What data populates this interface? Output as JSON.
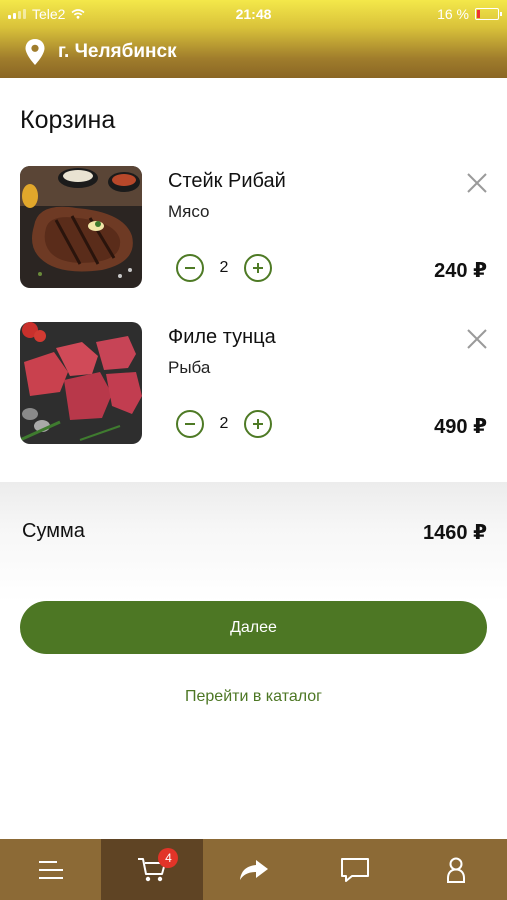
{
  "status_bar": {
    "carrier": "Tele2",
    "time": "21:48",
    "battery": "16 %",
    "battery_level": 0.16
  },
  "header": {
    "city": "г. Челябинск"
  },
  "page": {
    "title": "Корзина"
  },
  "cart_items": [
    {
      "name": "Стейк Рибай",
      "category": "Мясо",
      "quantity": "2",
      "price": "240 ₽"
    },
    {
      "name": "Филе тунца",
      "category": "Рыба",
      "quantity": "2",
      "price": "490 ₽"
    }
  ],
  "summary": {
    "label": "Сумма",
    "value": "1460 ₽"
  },
  "actions": {
    "next_label": "Далее",
    "catalog_label": "Перейти в каталог"
  },
  "tabbar": {
    "cart_badge": "4"
  },
  "colors": {
    "accent": "#4d7724",
    "tabbar": "#8c6a36",
    "tab_active": "#5f4424",
    "badge": "#e23428"
  }
}
